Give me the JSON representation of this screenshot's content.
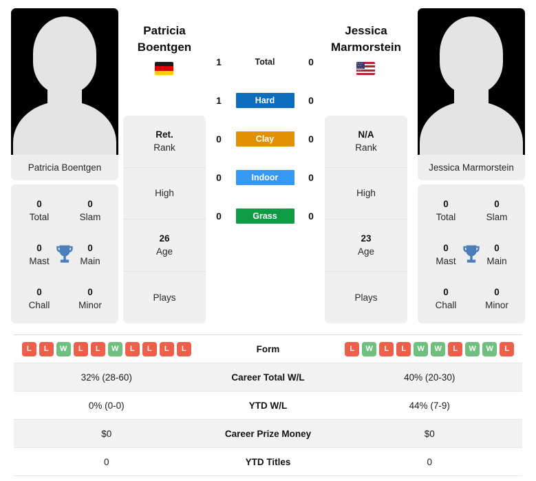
{
  "players": {
    "left": {
      "first_name": "Patricia",
      "last_name": "Boentgen",
      "full_name": "Patricia Boentgen",
      "flag": "de-flag-icon",
      "country": "Germany",
      "rank_value": "Ret.",
      "rank_label": "Rank",
      "high_value": "",
      "high_label": "High",
      "age_value": "26",
      "age_label": "Age",
      "plays_value": "",
      "plays_label": "Plays",
      "titles": {
        "total_value": "0",
        "total_label": "Total",
        "slam_value": "0",
        "slam_label": "Slam",
        "mast_value": "0",
        "mast_label": "Mast",
        "main_value": "0",
        "main_label": "Main",
        "chall_value": "0",
        "chall_label": "Chall",
        "minor_value": "0",
        "minor_label": "Minor"
      }
    },
    "right": {
      "first_name": "Jessica",
      "last_name": "Marmorstein",
      "full_name": "Jessica Marmorstein",
      "flag": "us-flag-icon",
      "country": "United States",
      "rank_value": "N/A",
      "rank_label": "Rank",
      "high_value": "",
      "high_label": "High",
      "age_value": "23",
      "age_label": "Age",
      "plays_value": "",
      "plays_label": "Plays",
      "titles": {
        "total_value": "0",
        "total_label": "Total",
        "slam_value": "0",
        "slam_label": "Slam",
        "mast_value": "0",
        "mast_label": "Mast",
        "main_value": "0",
        "main_label": "Main",
        "chall_value": "0",
        "chall_label": "Chall",
        "minor_value": "0",
        "minor_label": "Minor"
      }
    }
  },
  "head_to_head": {
    "rows": [
      {
        "label": "Total",
        "left": "1",
        "right": "0",
        "color": "transparent",
        "text_color": "#1a1a1a"
      },
      {
        "label": "Hard",
        "left": "1",
        "right": "0",
        "color": "#0c6cbe",
        "text_color": "#ffffff"
      },
      {
        "label": "Clay",
        "left": "0",
        "right": "0",
        "color": "#e09000",
        "text_color": "#ffffff"
      },
      {
        "label": "Indoor",
        "left": "0",
        "right": "0",
        "color": "#3399f3",
        "text_color": "#ffffff"
      },
      {
        "label": "Grass",
        "left": "0",
        "right": "0",
        "color": "#0f9b46",
        "text_color": "#ffffff"
      }
    ]
  },
  "stats_table": {
    "form": {
      "label": "Form",
      "left": [
        "L",
        "L",
        "W",
        "L",
        "L",
        "W",
        "L",
        "L",
        "L",
        "L"
      ],
      "right": [
        "L",
        "W",
        "L",
        "L",
        "W",
        "W",
        "L",
        "W",
        "W",
        "L"
      ]
    },
    "rows": [
      {
        "label": "Career Total W/L",
        "left": "32% (28-60)",
        "right": "40% (20-30)"
      },
      {
        "label": "YTD W/L",
        "left": "0% (0-0)",
        "right": "44% (7-9)"
      },
      {
        "label": "Career Prize Money",
        "left": "$0",
        "right": "$0"
      },
      {
        "label": "YTD Titles",
        "left": "0",
        "right": "0"
      }
    ]
  },
  "colors": {
    "win": "#6fbf7f",
    "loss": "#ee5f4a",
    "trophy": "#4a7ebb",
    "card_bg": "#eeeeee",
    "row_shade": "#f2f2f2"
  }
}
